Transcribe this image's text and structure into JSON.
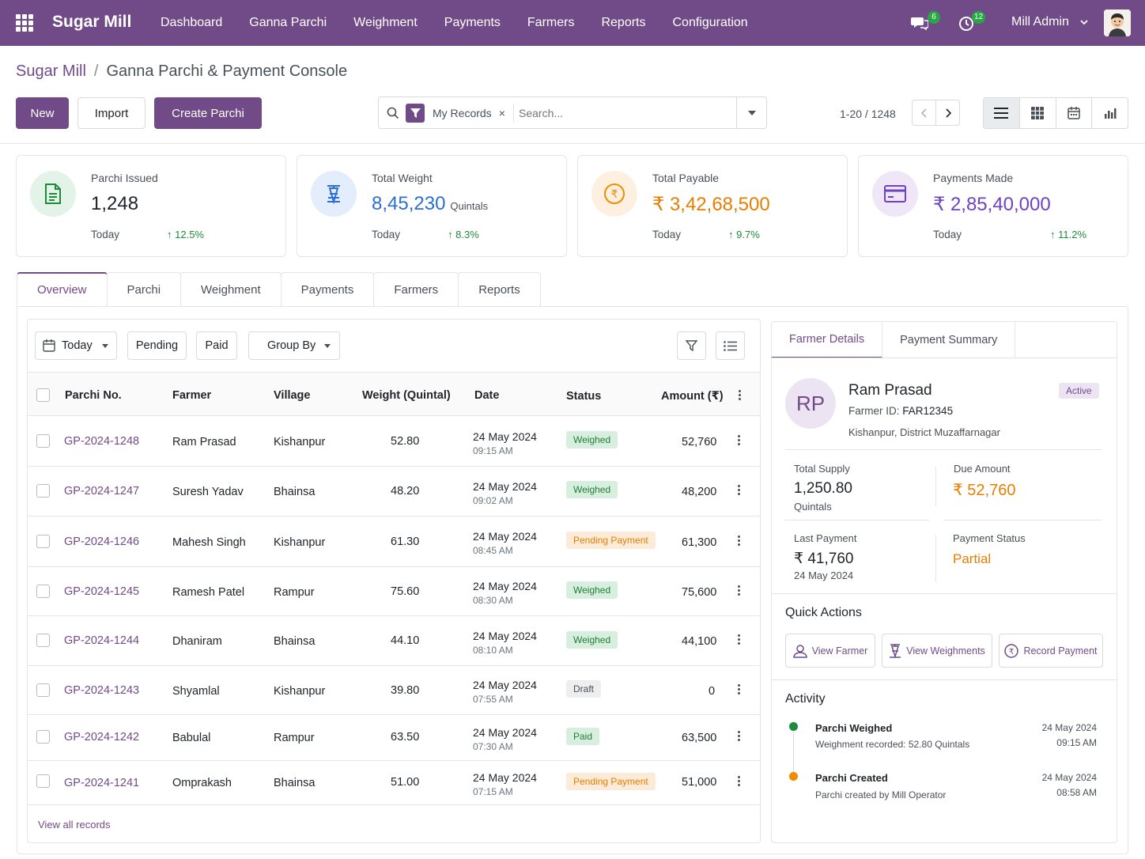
{
  "nav": {
    "brand": "Sugar Mill",
    "menu": [
      "Dashboard",
      "Ganna Parchi",
      "Weighment",
      "Payments",
      "Farmers",
      "Reports",
      "Configuration"
    ],
    "chat_count": "6",
    "activity_count": "12",
    "user": "Mill Admin"
  },
  "breadcrumb": {
    "root": "Sugar Mill",
    "sep": "/",
    "current": "Ganna Parchi & Payment Console"
  },
  "toolbar": {
    "new_label": "New",
    "import_label": "Import",
    "create_label": "Create Parchi"
  },
  "search": {
    "facet": "My Records",
    "remove": "×",
    "placeholder": "Search..."
  },
  "pager": {
    "text": "1-20 / 1248"
  },
  "kpis": [
    {
      "label": "Parchi Issued",
      "value": "1,248",
      "unit": "",
      "sub": "Today",
      "trend": "12.5%",
      "color": "#1e8a3b"
    },
    {
      "label": "Total Weight",
      "value": "8,45,230",
      "unit": "Quintals",
      "sub": "Today",
      "trend": "8.3%",
      "color": "#2b6fd6"
    },
    {
      "label": "Total Payable",
      "value": "₹ 3,42,68,500",
      "unit": "",
      "sub": "Today",
      "trend": "9.7%",
      "color": "#e67e00"
    },
    {
      "label": "Payments Made",
      "value": "₹ 2,85,40,000",
      "unit": "",
      "sub": "Today",
      "trend": "11.2%",
      "color": "#6f42c1"
    }
  ],
  "tabs": [
    "Overview",
    "Parchi",
    "Weighment",
    "Payments",
    "Farmers",
    "Reports"
  ],
  "filters": {
    "today": "Today",
    "pending": "Pending",
    "paid": "Paid",
    "group_by": "Group By"
  },
  "table": {
    "headers": {
      "parchi": "Parchi No.",
      "farmer": "Farmer",
      "village": "Village",
      "weight": "Weight (Quintal)",
      "date": "Date",
      "status": "Status",
      "amount": "Amount (₹)"
    },
    "rows": [
      {
        "parchi": "GP-2024-1248",
        "farmer": "Ram Prasad",
        "village": "Kishanpur",
        "weight": "52.80",
        "date": "24 May 2024",
        "time": "09:15 AM",
        "status": "Weighed",
        "amount": "52,760"
      },
      {
        "parchi": "GP-2024-1247",
        "farmer": "Suresh Yadav",
        "village": "Bhainsa",
        "weight": "48.20",
        "date": "24 May 2024",
        "time": "09:02 AM",
        "status": "Weighed",
        "amount": "48,200"
      },
      {
        "parchi": "GP-2024-1246",
        "farmer": "Mahesh Singh",
        "village": "Kishanpur",
        "weight": "61.30",
        "date": "24 May 2024",
        "time": "08:45 AM",
        "status": "Pending Payment",
        "amount": "61,300"
      },
      {
        "parchi": "GP-2024-1245",
        "farmer": "Ramesh Patel",
        "village": "Rampur",
        "weight": "75.60",
        "date": "24 May 2024",
        "time": "08:30 AM",
        "status": "Weighed",
        "amount": "75,600"
      },
      {
        "parchi": "GP-2024-1244",
        "farmer": "Dhaniram",
        "village": "Bhainsa",
        "weight": "44.10",
        "date": "24 May 2024",
        "time": "08:10 AM",
        "status": "Weighed",
        "amount": "44,100"
      },
      {
        "parchi": "GP-2024-1243",
        "farmer": "Shyamlal",
        "village": "Kishanpur",
        "weight": "39.80",
        "date": "24 May 2024",
        "time": "07:55 AM",
        "status": "Draft",
        "amount": "0"
      },
      {
        "parchi": "GP-2024-1242",
        "farmer": "Babulal",
        "village": "Rampur",
        "weight": "63.50",
        "date": "24 May 2024",
        "time": "07:30 AM",
        "status": "Paid",
        "amount": "63,500"
      },
      {
        "parchi": "GP-2024-1241",
        "farmer": "Omprakash",
        "village": "Bhainsa",
        "weight": "51.00",
        "date": "24 May 2024",
        "time": "07:15 AM",
        "status": "Pending Payment",
        "amount": "51,000"
      }
    ],
    "view_all": "View all records"
  },
  "side": {
    "tabs": [
      "Farmer Details",
      "Payment Summary"
    ],
    "initials": "RP",
    "name": "Ram Prasad",
    "farmer_id_label": "Farmer ID:",
    "farmer_id": "FAR12345",
    "location": "Kishanpur, District Muzaffarnagar",
    "status": "Active",
    "total_supply_label": "Total Supply",
    "total_supply": "1,250.80",
    "total_supply_unit": "Quintals",
    "due_label": "Due Amount",
    "due": "₹ 52,760",
    "last_payment_label": "Last Payment",
    "last_payment": "₹ 41,760",
    "last_payment_date": "24 May 2024",
    "payment_status_label": "Payment Status",
    "payment_status": "Partial",
    "quick_actions_title": "Quick Actions",
    "quick_actions": [
      "View Farmer",
      "View Weighments",
      "Record Payment"
    ],
    "activity_title": "Activity",
    "activity": [
      {
        "title": "Parchi Weighed",
        "desc": "Weighment recorded: 52.80 Quintals",
        "date": "24 May 2024",
        "time": "09:15 AM",
        "color": "#1e8a3b"
      },
      {
        "title": "Parchi Created",
        "desc": "Parchi created by Mill Operator",
        "date": "24 May 2024",
        "time": "08:58 AM",
        "color": "#f08c00"
      }
    ]
  }
}
